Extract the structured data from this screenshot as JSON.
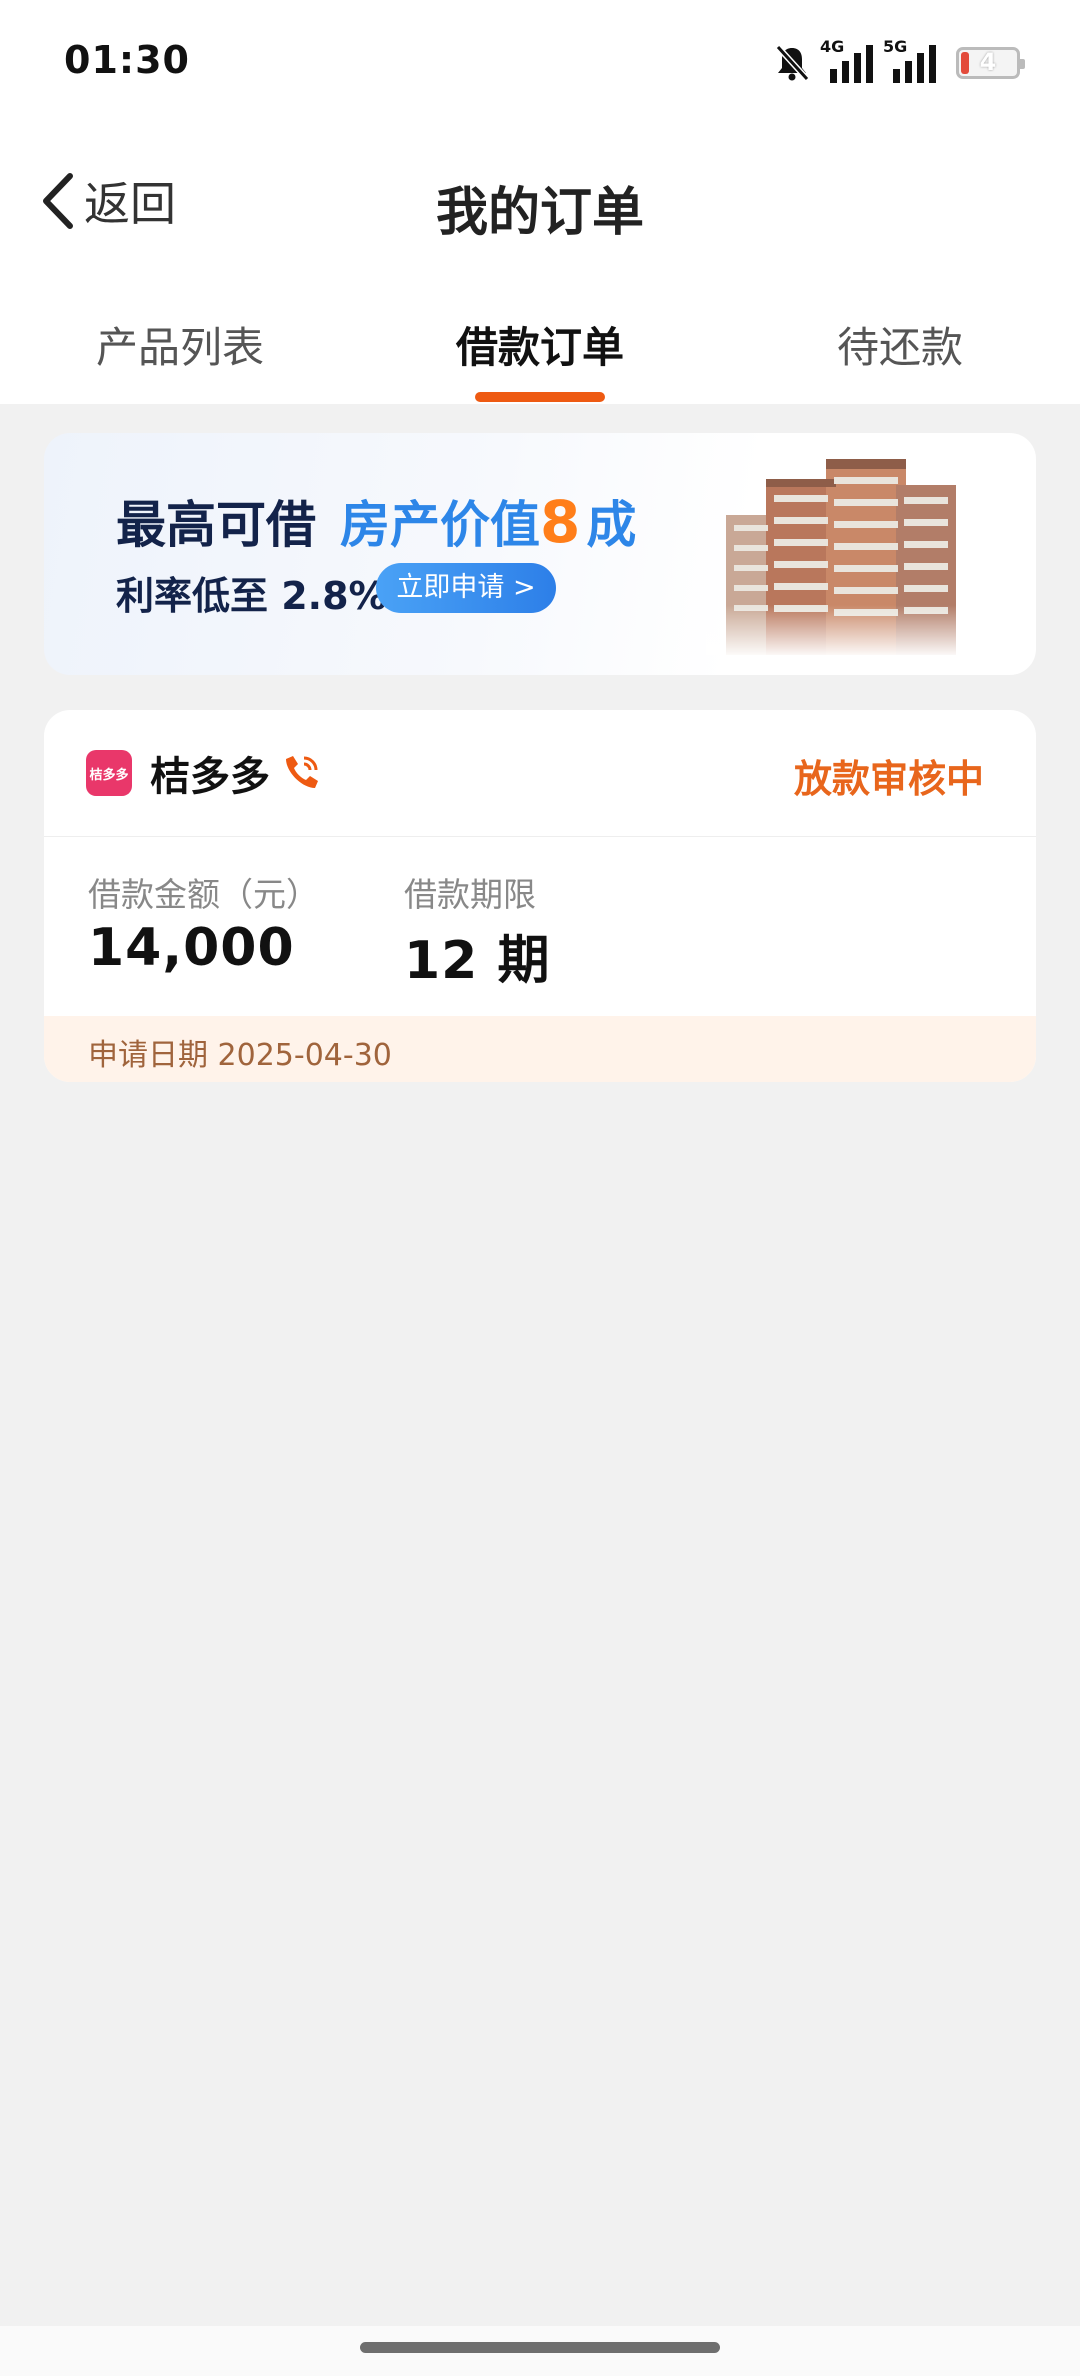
{
  "status_bar": {
    "time": "01:30",
    "network_1": "4G",
    "network_2": "5G",
    "battery": "4",
    "icons": [
      "bell-muted-icon",
      "signal-4g-icon",
      "signal-5g-icon",
      "battery-icon"
    ]
  },
  "nav": {
    "back_label": "返回",
    "title": "我的订单"
  },
  "tabs": [
    {
      "label": "产品列表",
      "active": false
    },
    {
      "label": "借款订单",
      "active": true
    },
    {
      "label": "待还款",
      "active": false
    }
  ],
  "banner": {
    "line1_prefix": "最高可借",
    "line1_highlight": "房产价值",
    "line1_number": "8",
    "line1_suffix": "成",
    "line2": "利率低至 2.8%",
    "apply_button": "立即申请 >"
  },
  "order": {
    "lender_name": "桔多多",
    "lender_logo_text": "桔多多",
    "status": "放款审核中",
    "amount_label": "借款金额（元）",
    "amount_value": "14,000",
    "term_label": "借款期限",
    "term_value": "12 期",
    "apply_date": "申请日期 2025-04-30"
  },
  "colors": {
    "accent": "#f0640f",
    "tab_underline": "#ee5a12",
    "status": "#e8661c",
    "banner_blue": "#2d86e8",
    "banner_orange": "#ff7e1a",
    "footer_bg": "#fff3ea"
  }
}
